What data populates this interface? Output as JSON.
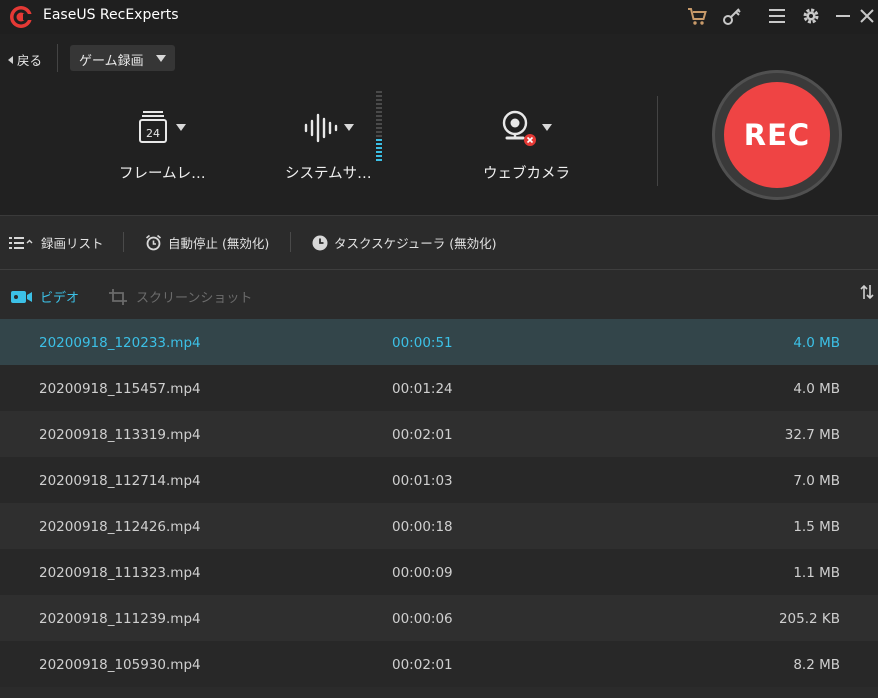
{
  "app": {
    "title": "EaseUS RecExperts"
  },
  "titlebar_icons": [
    "cart-icon",
    "key-icon",
    "menu-icon",
    "gear-icon",
    "minimize-icon",
    "close-icon"
  ],
  "nav": {
    "back_label": "戻る",
    "mode_selected": "ゲーム録画"
  },
  "options": {
    "frame_rate": {
      "label": "フレームレ…",
      "value": "24"
    },
    "system_sound": {
      "label": "システムサ…"
    },
    "webcam": {
      "label": "ウェブカメラ"
    }
  },
  "rec": {
    "label": "REC",
    "color": "#ef4444"
  },
  "toolbar": {
    "record_list": "録画リスト",
    "auto_stop": "自動停止 (無効化)",
    "task_scheduler": "タスクスケジューラ (無効化)"
  },
  "tabs": {
    "video": "ビデオ",
    "screenshot": "スクリーンショット"
  },
  "files": [
    {
      "name": "20200918_120233.mp4",
      "duration": "00:00:51",
      "size": "4.0 MB"
    },
    {
      "name": "20200918_115457.mp4",
      "duration": "00:01:24",
      "size": "4.0 MB"
    },
    {
      "name": "20200918_113319.mp4",
      "duration": "00:02:01",
      "size": "32.7 MB"
    },
    {
      "name": "20200918_112714.mp4",
      "duration": "00:01:03",
      "size": "7.0 MB"
    },
    {
      "name": "20200918_112426.mp4",
      "duration": "00:00:18",
      "size": "1.5 MB"
    },
    {
      "name": "20200918_111323.mp4",
      "duration": "00:00:09",
      "size": "1.1 MB"
    },
    {
      "name": "20200918_111239.mp4",
      "duration": "00:00:06",
      "size": "205.2 KB"
    },
    {
      "name": "20200918_105930.mp4",
      "duration": "00:02:01",
      "size": "8.2 MB"
    }
  ],
  "colors": {
    "accent": "#3cc0e6",
    "selected_row": "#33454a"
  }
}
